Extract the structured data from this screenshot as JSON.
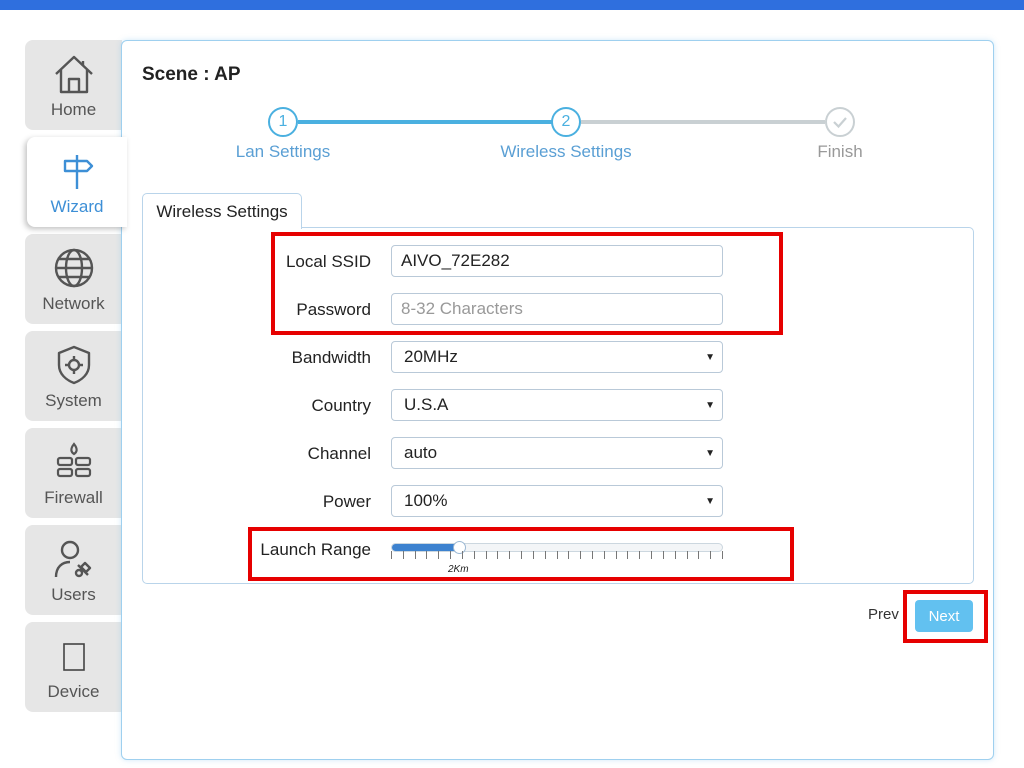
{
  "colors": {
    "topbar": "#2f6fde",
    "accent": "#4ab0e0",
    "active_nav": "#3d8fd6",
    "next_button": "#62c1f0",
    "highlight": "#e60000"
  },
  "sidebar": {
    "items": [
      {
        "label": "Home",
        "icon": "home-icon",
        "active": false
      },
      {
        "label": "Wizard",
        "icon": "signpost-icon",
        "active": true
      },
      {
        "label": "Network",
        "icon": "globe-icon",
        "active": false
      },
      {
        "label": "System",
        "icon": "shield-gear-icon",
        "active": false
      },
      {
        "label": "Firewall",
        "icon": "firewall-icon",
        "active": false
      },
      {
        "label": "Users",
        "icon": "user-wrench-icon",
        "active": false
      },
      {
        "label": "Device",
        "icon": "device-icon",
        "active": false
      }
    ]
  },
  "main": {
    "scene_title": "Scene : AP",
    "steps": [
      {
        "number": "1",
        "label": "Lan Settings",
        "state": "done"
      },
      {
        "number": "2",
        "label": "Wireless Settings",
        "state": "current"
      },
      {
        "number": "",
        "label": "Finish",
        "state": "pending",
        "icon": "check-icon"
      }
    ],
    "progress_segments_complete": 1,
    "tab_label": "Wireless Settings",
    "form": {
      "ssid_label": "Local SSID",
      "ssid_value": "AIVO_72E282",
      "password_label": "Password",
      "password_placeholder": "8-32 Characters",
      "bandwidth_label": "Bandwidth",
      "bandwidth_value": "20MHz",
      "country_label": "Country",
      "country_value": "U.S.A",
      "channel_label": "Channel",
      "channel_value": "auto",
      "power_label": "Power",
      "power_value": "100%",
      "launch_range_label": "Launch Range",
      "launch_range_value": "2Km",
      "launch_range_fraction": 0.2
    },
    "prev_label": "Prev",
    "next_label": "Next"
  }
}
